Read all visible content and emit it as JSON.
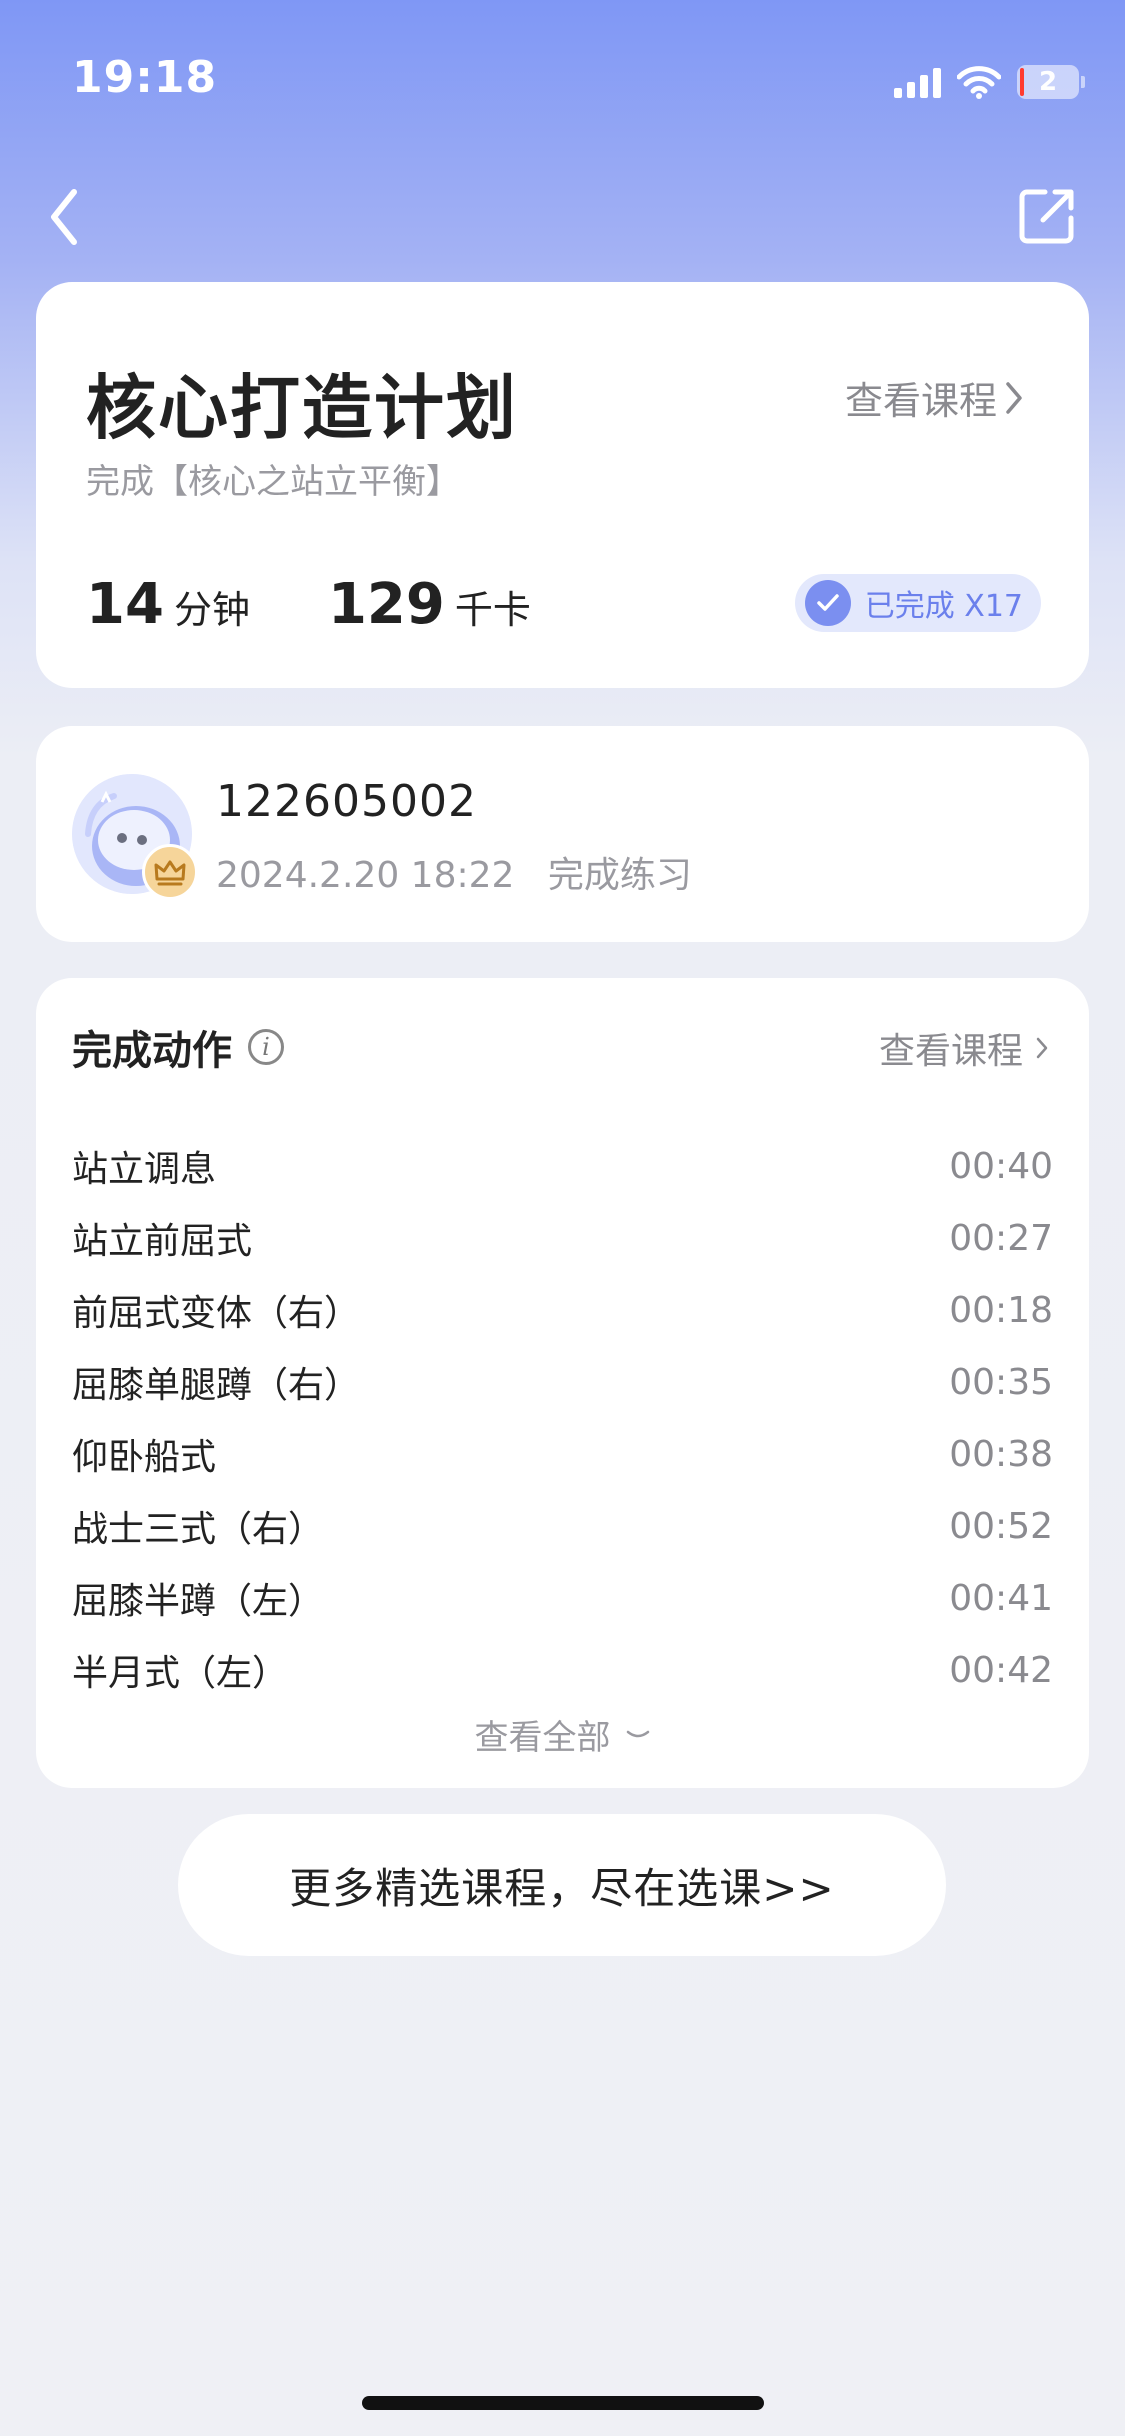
{
  "status_bar": {
    "time": "19:18",
    "battery": "2"
  },
  "icons": {
    "back": "chevron-left-icon",
    "share": "share-icon",
    "info": "info-icon",
    "check": "check-icon",
    "crown": "crown-icon"
  },
  "colors": {
    "accent": "#7b8ff0",
    "badge_bg": "#e3e8fc",
    "battery_low": "#ff3b30"
  },
  "plan": {
    "title": "核心打造计划",
    "view_course": "查看课程",
    "subtitle": "完成【核心之站立平衡】",
    "duration_value": "14",
    "duration_unit": "分钟",
    "calories_value": "129",
    "calories_unit": "千卡",
    "completed_badge": "已完成 X17"
  },
  "user": {
    "id": "122605002",
    "date": "2024.2.20 18:22",
    "status": "完成练习"
  },
  "actions_section": {
    "title": "完成动作",
    "view_course": "查看课程",
    "items": [
      {
        "name": "站立调息",
        "time": "00:40"
      },
      {
        "name": "站立前屈式",
        "time": "00:27"
      },
      {
        "name": "前屈式变体（右）",
        "time": "00:18"
      },
      {
        "name": "屈膝单腿蹲（右）",
        "time": "00:35"
      },
      {
        "name": "仰卧船式",
        "time": "00:38"
      },
      {
        "name": "战士三式（右）",
        "time": "00:52"
      },
      {
        "name": "屈膝半蹲（左）",
        "time": "00:41"
      },
      {
        "name": "半月式（左）",
        "time": "00:42"
      }
    ],
    "view_all": "查看全部"
  },
  "more_button": "更多精选课程，尽在选课>>"
}
